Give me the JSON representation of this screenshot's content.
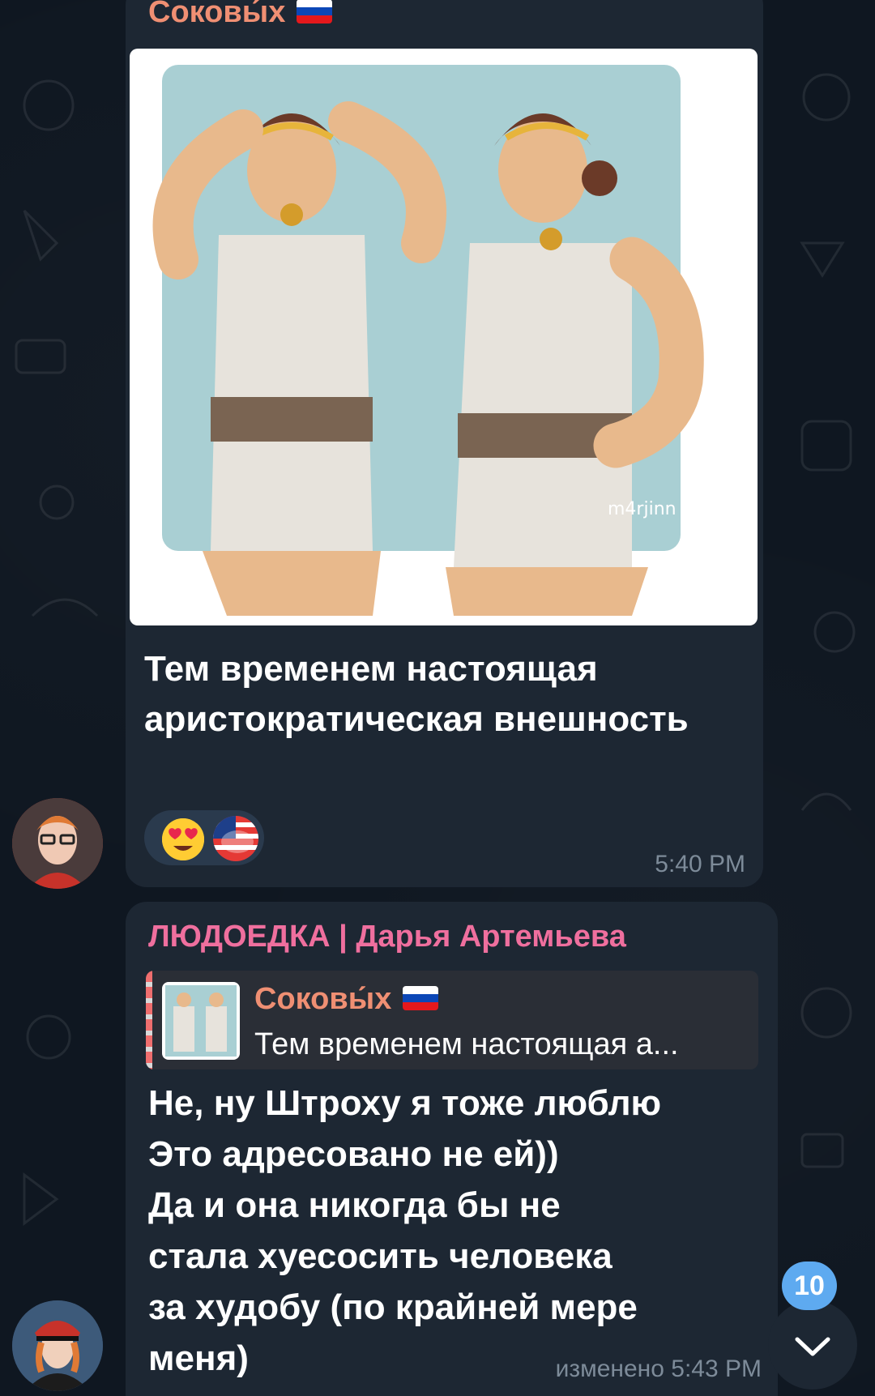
{
  "messages": [
    {
      "sender": "Соковы́х",
      "flag": "ru-flag",
      "image_signature": "m4rjinn",
      "caption": "Тем временем настоящая аристократическая внешность",
      "reactions": [
        "heart-eyes-emoji",
        "usa-pepe-emoji"
      ],
      "time": "5:40 PM"
    },
    {
      "sender": "ЛЮДОЕДКА | Дарья Артемьева",
      "reply": {
        "sender": "Соковы́х",
        "text": "Тем временем настоящая а..."
      },
      "text": "Не, ну Штроху я тоже люблю\nЭто адресовано не ей))\nДа и она никогда бы не\nстала хуесосить человека\nза худобу (по крайней мере\nменя)",
      "time": "изменено 5:43 PM"
    }
  ],
  "unread_count": "10",
  "colors": {
    "background": "#0f1721",
    "bubble": "#1d2733",
    "sender1": "#ef8f73",
    "sender2": "#ef6f9e",
    "badge": "#5eaaf0"
  }
}
